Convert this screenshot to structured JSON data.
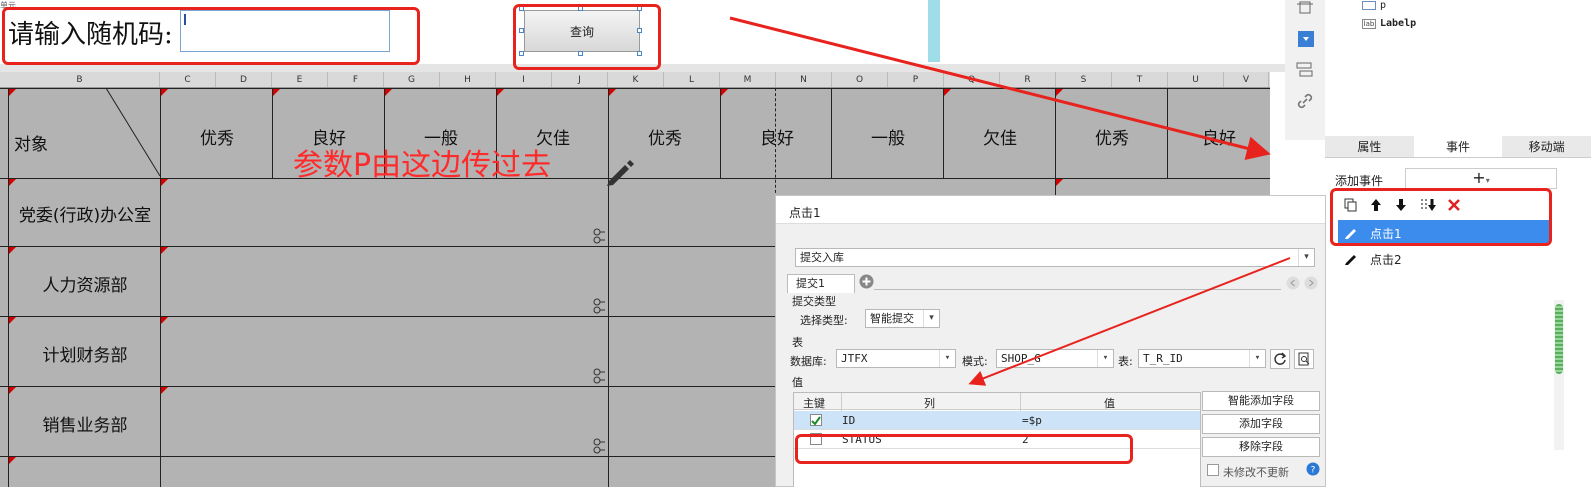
{
  "top": {
    "corner_mark": "单元",
    "prompt": "请输入随机码:",
    "query_button": "查询",
    "annotation": "参数P由这边传过去"
  },
  "sheet": {
    "columns": [
      "B",
      "C",
      "D",
      "E",
      "F",
      "G",
      "H",
      "I",
      "J",
      "K",
      "L",
      "M",
      "N",
      "O",
      "P",
      "Q",
      "R",
      "S",
      "T",
      "U",
      "V"
    ],
    "header_label": "对象",
    "grades": [
      "优秀",
      "良好",
      "一般",
      "欠佳",
      "优秀",
      "良好",
      "一般",
      "欠佳",
      "优秀",
      "良好"
    ],
    "rows": [
      "党委(行政)办公室",
      "人力资源部",
      "计划财务部",
      "销售业务部"
    ]
  },
  "tree": {
    "items": [
      {
        "icon": "text-icon",
        "label": "p"
      },
      {
        "icon": "label-icon",
        "label": "Labelp"
      }
    ]
  },
  "panel_tabs": [
    "属性",
    "事件",
    "移动端"
  ],
  "events": {
    "add_label": "添加事件",
    "add_symbol": "+",
    "items": [
      "点击1",
      "点击2"
    ]
  },
  "dialog": {
    "title": "点击1",
    "action": "提交入库",
    "sub_tab": "提交1",
    "submit_type_section": "提交类型",
    "select_type_label": "选择类型:",
    "select_type_value": "智能提交",
    "table_section": "表",
    "db_label": "数据库:",
    "db_value": "JTFX",
    "schema_label": "模式:",
    "schema_value": "SHOP_G",
    "table_label": "表:",
    "table_value": "T_R_ID",
    "value_section": "值",
    "grid_headers": [
      "主键",
      "列",
      "值"
    ],
    "grid_rows": [
      {
        "key": true,
        "column": "ID",
        "value": "=$p"
      },
      {
        "key": false,
        "column": "STATUS",
        "value": "2"
      }
    ],
    "buttons": [
      "智能添加字段",
      "添加字段",
      "移除字段"
    ],
    "no_update_label": "未修改不更新"
  }
}
